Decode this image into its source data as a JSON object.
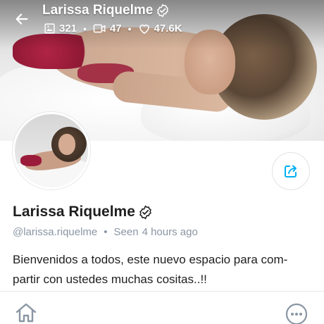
{
  "header": {
    "title": "Larissa Riquelme",
    "stats": {
      "photos": "321",
      "videos": "47",
      "likes": "47.6K"
    }
  },
  "profile": {
    "name": "Larissa Riquelme",
    "username": "@larissa.riquelme",
    "seen_label": "Seen",
    "seen_time": "4 hours ago",
    "bio": "Bienvenidos a todos, este nuevo espacio para com-partir con ustedes muchas cositas..!!"
  },
  "icons": {
    "back": "arrow-left-icon",
    "verified": "verified-badge-icon",
    "photos": "image-icon",
    "videos": "video-icon",
    "likes": "heart-icon",
    "share": "share-icon",
    "home": "home-icon",
    "more": "more-icon"
  },
  "colors": {
    "accent": "#00aff0",
    "muted": "#8a96a3",
    "text": "#1f1f1f"
  }
}
